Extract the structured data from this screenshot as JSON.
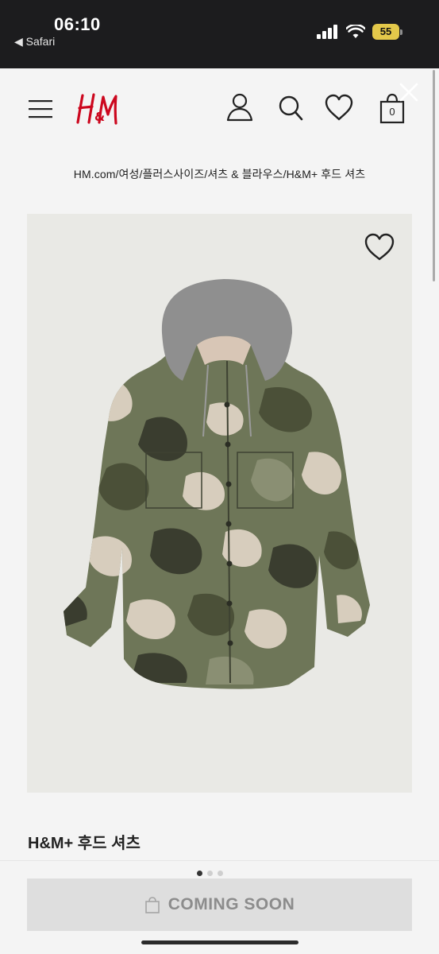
{
  "status_bar": {
    "time": "06:10",
    "back_label": "◀ Safari",
    "battery": "55"
  },
  "header": {
    "logo_text": "H&M",
    "brand_color": "#cc071e"
  },
  "breadcrumb": "HM.com/여성/플러스사이즈/셔츠 & 블라우스/H&M+ 후드 셔츠",
  "product": {
    "title": "H&M+ 후드 셔츠",
    "image_subject": "camo hooded shirt"
  },
  "cart": {
    "count": "0"
  },
  "cta": {
    "label": "COMING SOON"
  },
  "gallery": {
    "current": 1,
    "total": 3
  }
}
